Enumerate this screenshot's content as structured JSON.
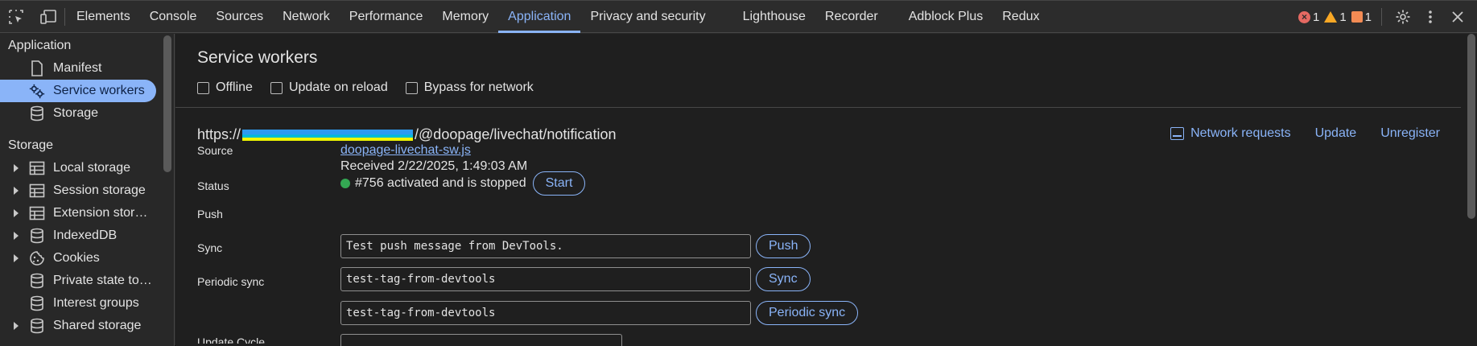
{
  "toolbar": {
    "tabs": [
      "Elements",
      "Console",
      "Sources",
      "Network",
      "Performance",
      "Memory",
      "Application",
      "Privacy and security",
      "Lighthouse",
      "Recorder",
      "Adblock Plus",
      "Redux"
    ],
    "active_tab": "Application",
    "error_count": "1",
    "warning_count": "1",
    "issue_count": "1",
    "colors": {
      "accent": "#8ab4f8",
      "error": "#e46962",
      "warning": "#f9a825",
      "issue": "#f28b54"
    }
  },
  "sidebar": {
    "application_header": "Application",
    "application_items": [
      {
        "label": "Manifest",
        "icon": "document-icon"
      },
      {
        "label": "Service workers",
        "icon": "gears-icon"
      },
      {
        "label": "Storage",
        "icon": "database-icon"
      }
    ],
    "selected_item": "Service workers",
    "storage_header": "Storage",
    "storage_items": [
      {
        "label": "Local storage",
        "icon": "table-icon",
        "expandable": true
      },
      {
        "label": "Session storage",
        "icon": "table-icon",
        "expandable": true
      },
      {
        "label": "Extension stor…",
        "icon": "table-icon",
        "expandable": true
      },
      {
        "label": "IndexedDB",
        "icon": "database-icon",
        "expandable": true
      },
      {
        "label": "Cookies",
        "icon": "cookie-icon",
        "expandable": true
      },
      {
        "label": "Private state to…",
        "icon": "database-icon",
        "expandable": false
      },
      {
        "label": "Interest groups",
        "icon": "database-icon",
        "expandable": false
      },
      {
        "label": "Shared storage",
        "icon": "database-icon",
        "expandable": true
      }
    ]
  },
  "main": {
    "title": "Service workers",
    "options": [
      "Offline",
      "Update on reload",
      "Bypass for network"
    ],
    "scope_prefix": "https://",
    "scope_suffix": "/@doopage/livechat/notification",
    "actions": {
      "network_requests": "Network requests",
      "update": "Update",
      "unregister": "Unregister"
    },
    "source_label": "Source",
    "source_link": "doopage-livechat-sw.js",
    "received": "Received 2/22/2025, 1:49:03 AM",
    "status_label": "Status",
    "status_text": "#756 activated and is stopped",
    "status_color": "#34a853",
    "start_button": "Start",
    "push_label": "Push",
    "push_value": "Test push message from DevTools.",
    "push_button": "Push",
    "sync_label": "Sync",
    "sync_value": "test-tag-from-devtools",
    "sync_button": "Sync",
    "periodic_label": "Periodic sync",
    "periodic_value": "test-tag-from-devtools",
    "periodic_button": "Periodic sync",
    "update_cycle_label": "Update Cycle"
  }
}
